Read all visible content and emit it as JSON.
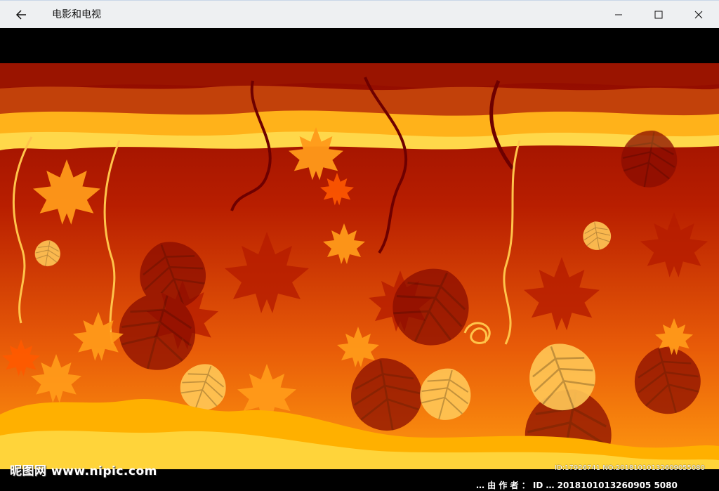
{
  "window": {
    "title": "电影和电视",
    "back_icon": "arrow-left-icon",
    "minimize_icon": "minimize-icon",
    "maximize_icon": "maximize-icon",
    "close_icon": "close-icon"
  },
  "video": {
    "description_icon": "autumn-leaves-artwork",
    "colors": {
      "deep_red": "#8b0000",
      "orange": "#e8590c",
      "yellow": "#ffc400"
    }
  },
  "watermark": {
    "logo": "昵图网 www.nipic.com",
    "id_text": "ID:17926741 NO:20181010132609055080",
    "bottom_partial": "… 由 作 者 ： ID …  2018101013260905 5080"
  }
}
